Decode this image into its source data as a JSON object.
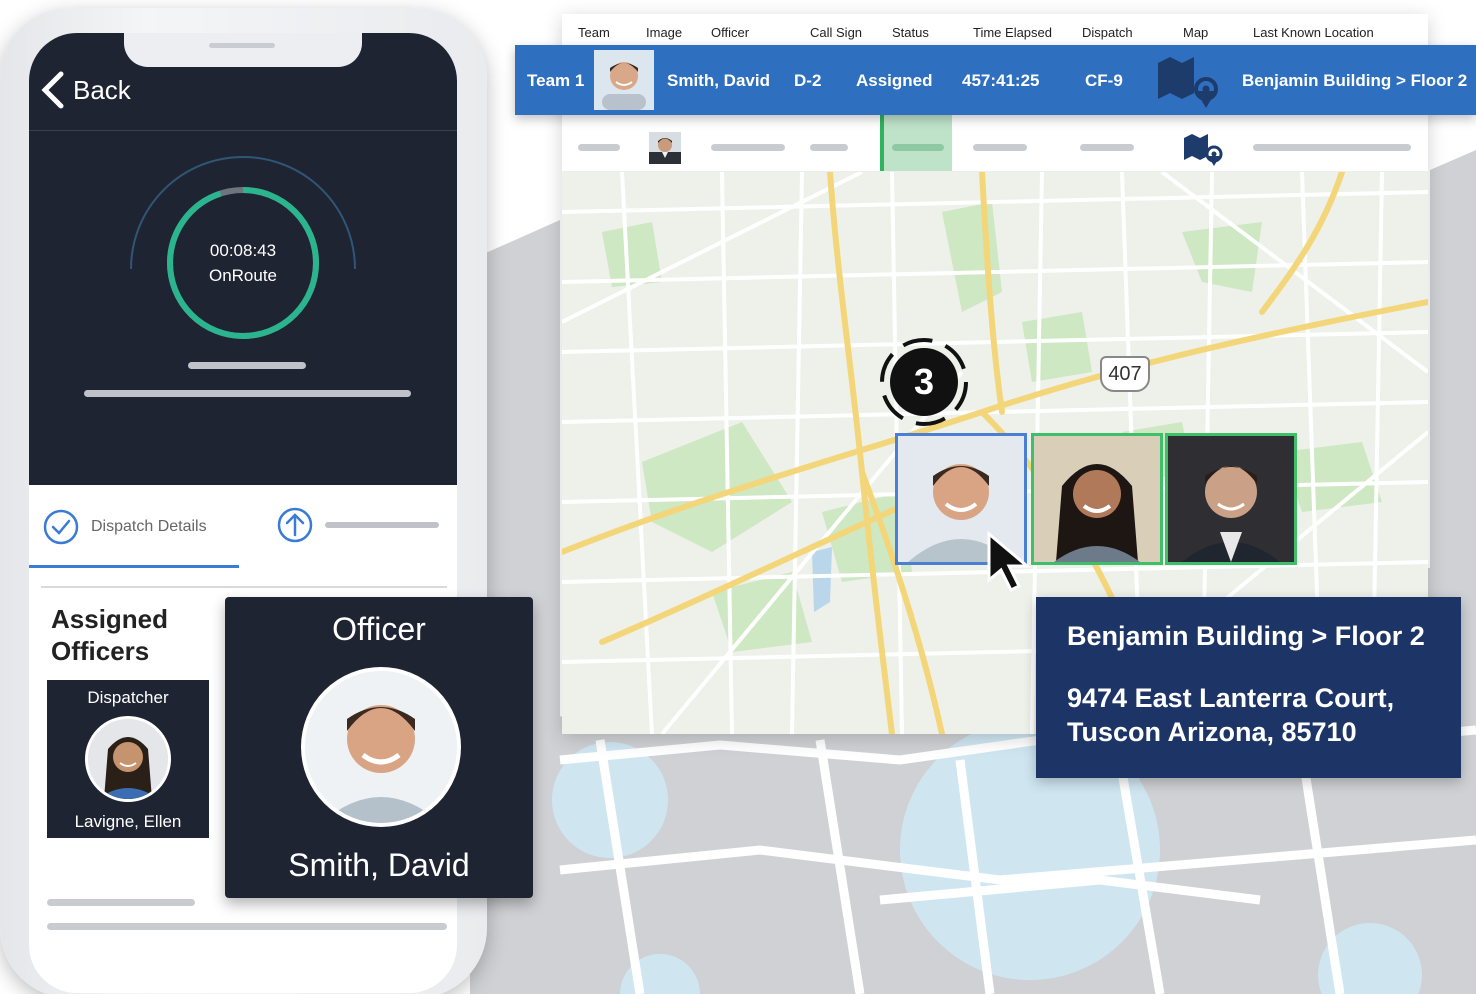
{
  "table": {
    "headers": [
      "Team",
      "Image",
      "Officer",
      "Call Sign",
      "Status",
      "Time Elapsed",
      "Dispatch",
      "Map",
      "Last Known Location"
    ]
  },
  "active_row": {
    "team": "Team 1",
    "officer": "Smith, David",
    "call_sign": "D-2",
    "status": "Assigned",
    "time_elapsed": "457:41:25",
    "dispatch": "CF-9",
    "map_icon": "map-pin-icon",
    "last_known_location": "Benjamin Building > Floor 2"
  },
  "map": {
    "highway_label": "407",
    "cluster_count": "3"
  },
  "location_popup": {
    "title": "Benjamin Building > Floor 2",
    "address": "9474 East Lanterra Court, Tuscon Arizona, 85710"
  },
  "phone": {
    "back_label": "Back",
    "timer": "00:08:43",
    "timer_status": "OnRoute",
    "progress": 0.95,
    "tab_dispatch": "Dispatch Details",
    "assigned_title": "Assigned Officers",
    "dispatcher": {
      "role": "Dispatcher",
      "name": "Lavigne, Ellen"
    },
    "officer": {
      "role": "Officer",
      "name": "Smith, David"
    }
  },
  "colors": {
    "row_blue": "#2e6fbf",
    "dark_panel": "#1f2433",
    "timer_green": "#2bb58e",
    "location_navy": "#1c3466",
    "status_green": "#3fbf6a"
  }
}
